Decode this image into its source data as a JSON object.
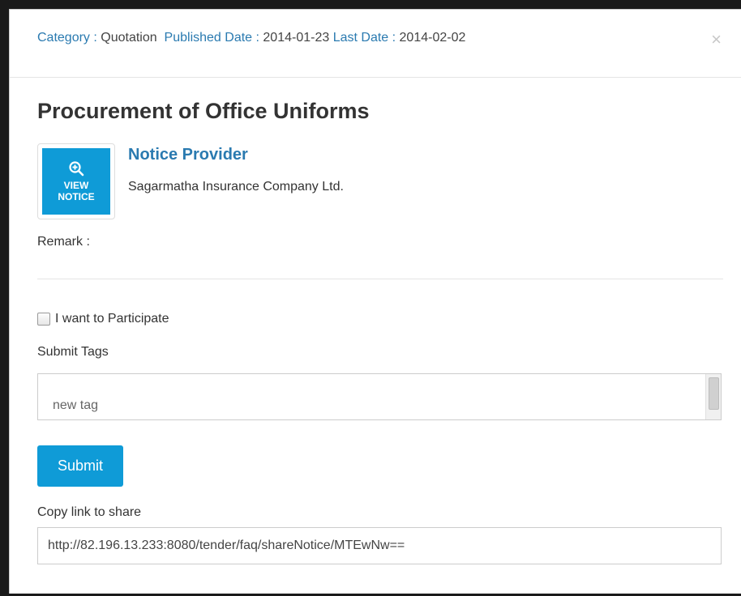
{
  "header": {
    "category_label": "Category :",
    "category_value": "Quotation",
    "published_label": "Published Date :",
    "published_value": "2014-01-23",
    "last_label": "Last Date :",
    "last_value": "2014-02-02",
    "close_glyph": "×"
  },
  "notice": {
    "title": "Procurement of Office Uniforms",
    "thumb_line1": "VIEW",
    "thumb_line2": "NOTICE",
    "provider_label": "Notice Provider",
    "provider_name": "Sagarmatha Insurance Company Ltd.",
    "remark_label": "Remark :"
  },
  "form": {
    "participate_label": "I want to Participate",
    "participate_checked": false,
    "tags_label": "Submit Tags",
    "tag_placeholder": "new tag",
    "submit_label": "Submit",
    "copy_label": "Copy link to share",
    "share_link": "http://82.196.13.233:8080/tender/faq/shareNotice/MTEwNw=="
  },
  "colors": {
    "accent": "#0f9bd7",
    "link": "#2a7ab0",
    "overlay": "#1a1a1a"
  }
}
